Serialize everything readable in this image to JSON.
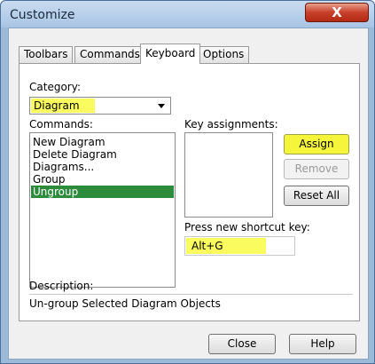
{
  "window": {
    "title": "Customize",
    "close_glyph": "X"
  },
  "tabs": [
    {
      "label": "Toolbars"
    },
    {
      "label": "Commands"
    },
    {
      "label": "Keyboard",
      "active": true
    },
    {
      "label": "Options"
    }
  ],
  "category": {
    "label": "Category:",
    "value": "Diagram"
  },
  "commands": {
    "label": "Commands:",
    "items": [
      "New Diagram",
      "Delete Diagram",
      "Diagrams...",
      "Group",
      "Ungroup"
    ],
    "selected": "Ungroup"
  },
  "key_assignments": {
    "label": "Key assignments:"
  },
  "buttons": {
    "assign": "Assign",
    "remove": "Remove",
    "reset_all": "Reset All",
    "close": "Close",
    "help": "Help"
  },
  "shortcut": {
    "label": "Press new shortcut key:",
    "value": "Alt+G"
  },
  "description": {
    "label": "Description:",
    "text": "Un-group Selected Diagram Objects"
  },
  "colors": {
    "highlight": "#fafb5e",
    "selection": "#2c8c3c"
  }
}
